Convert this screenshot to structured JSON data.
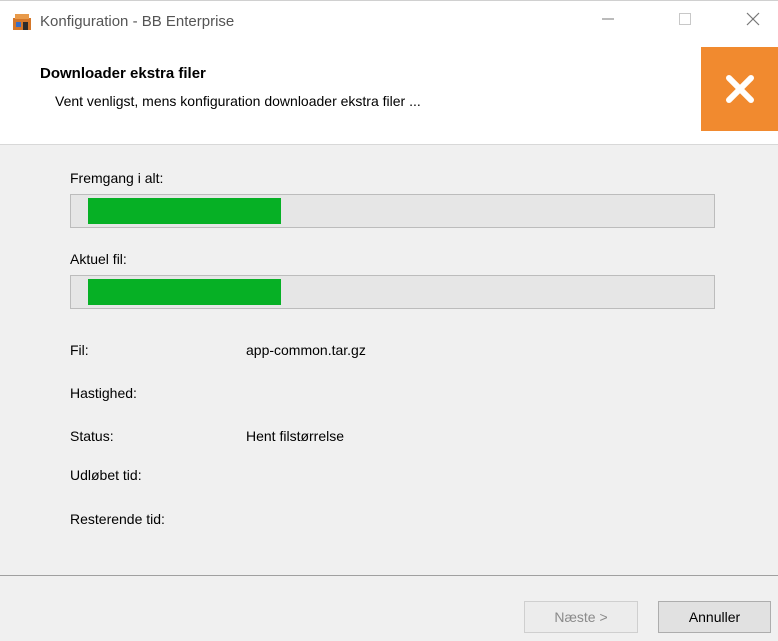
{
  "window": {
    "title": "Konfiguration - BB Enterprise"
  },
  "header": {
    "title": "Downloader ekstra filer",
    "subtitle": "Vent venligst, mens konfiguration downloader ekstra filer ..."
  },
  "progress": {
    "overall_label": "Fremgang i alt:",
    "overall_fraction": 0.31,
    "current_label": "Aktuel fil:",
    "current_fraction": 0.31,
    "fill_color": "#06b025"
  },
  "details": {
    "file_label": "Fil:",
    "file_value": "app-common.tar.gz",
    "speed_label": "Hastighed:",
    "status_label": "Status:",
    "status_value": "Hent filstørrelse",
    "elapsed_label": "Udløbet tid:",
    "remaining_label": "Resterende tid:"
  },
  "buttons": {
    "next_label": "Næste >",
    "cancel_label": "Annuller"
  },
  "colors": {
    "logo_bg": "#f18a2f"
  }
}
